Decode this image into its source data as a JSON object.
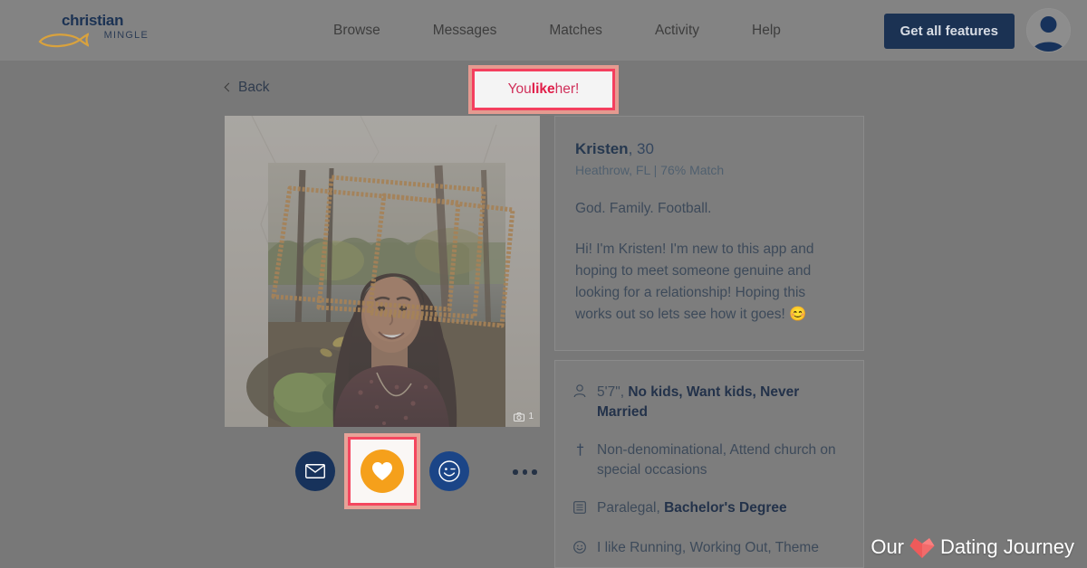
{
  "header": {
    "logo_word": "christian",
    "logo_sub": "MINGLE",
    "logo_icon": "fish-icon",
    "nav": [
      {
        "label": "Browse"
      },
      {
        "label": "Messages"
      },
      {
        "label": "Matches"
      },
      {
        "label": "Activity"
      },
      {
        "label": "Help"
      }
    ],
    "cta_label": "Get all features",
    "avatar_icon": "user-silhouette-avatar"
  },
  "subbar": {
    "back_label": "Back",
    "back_icon": "chevron-left-icon",
    "like_banner": {
      "prefix": "You ",
      "emphasis": "like",
      "suffix": " her!"
    }
  },
  "photo": {
    "badge_icon": "camera-icon",
    "badge_count": "1"
  },
  "actions": {
    "message_icon": "envelope-icon",
    "like_icon": "heart-icon",
    "wink_icon": "wink-smiley-icon",
    "more_icon": "ellipsis-icon"
  },
  "profile": {
    "name": "Kristen",
    "age": ", 30",
    "meta": "Heathrow, FL | 76% Match",
    "tagline": "God. Family. Football.",
    "bio": "Hi! I'm Kristen! I'm new to this app and hoping to meet someone genuine and looking for a relationship! Hoping this works out so lets see how it goes! 😊"
  },
  "details": [
    {
      "icon": "person-icon",
      "plain": "5'7\", ",
      "bold": "No kids, Want kids, Never Married",
      "trailing": ""
    },
    {
      "icon": "cross-icon",
      "plain": "Non-denominational, Attend church on special occasions",
      "bold": "",
      "trailing": ""
    },
    {
      "icon": "document-icon",
      "plain": "Paralegal, ",
      "bold": "Bachelor's Degree",
      "trailing": ""
    },
    {
      "icon": "smiley-icon",
      "plain": "I like Running, Working Out, Theme",
      "bold": "",
      "trailing": ""
    }
  ],
  "watermark": {
    "text_before": "Our",
    "heart_icon": "heart-icon",
    "text_after": "Dating Journey"
  },
  "colors": {
    "brand_navy": "#1b3253",
    "accent_orange": "#f5a01b",
    "highlight_pink": "#f4475f",
    "page_overlay": "#787878"
  }
}
